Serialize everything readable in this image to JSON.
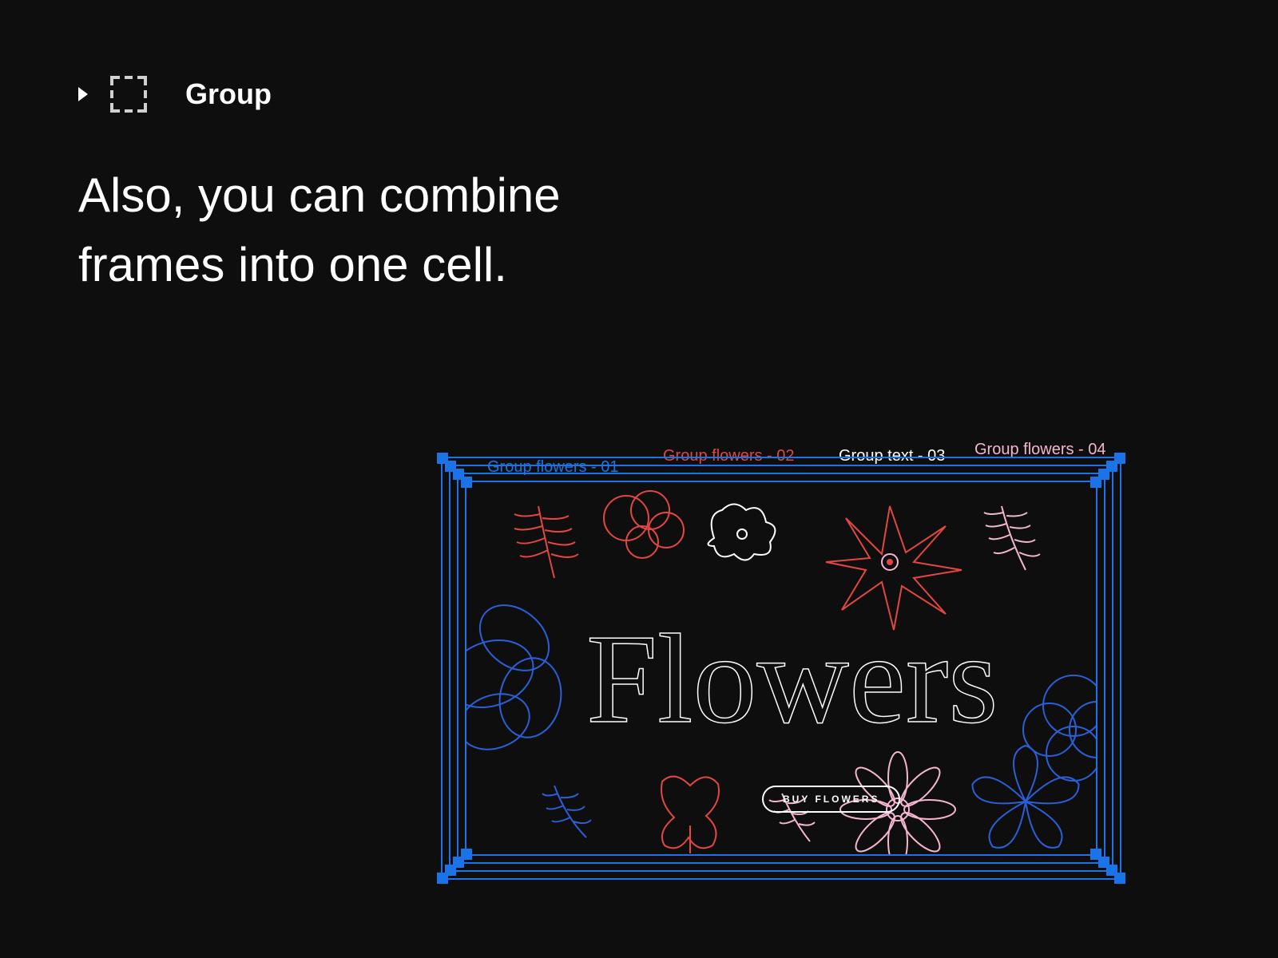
{
  "header": {
    "layer_label": "Group"
  },
  "headline": "Also, you can combine frames into one cell.",
  "frames": {
    "label1": "Group flowers - 01",
    "label2": "Group flowers - 02",
    "label3": "Group text - 03",
    "label4": "Group flowers - 04"
  },
  "design": {
    "hero_text": "Flowers",
    "button_label": "BUY FLOWERS"
  },
  "colors": {
    "selection": "#1a73e8",
    "red": "#e24741",
    "pink": "#f4b6d0",
    "blue": "#2b5fd9"
  }
}
